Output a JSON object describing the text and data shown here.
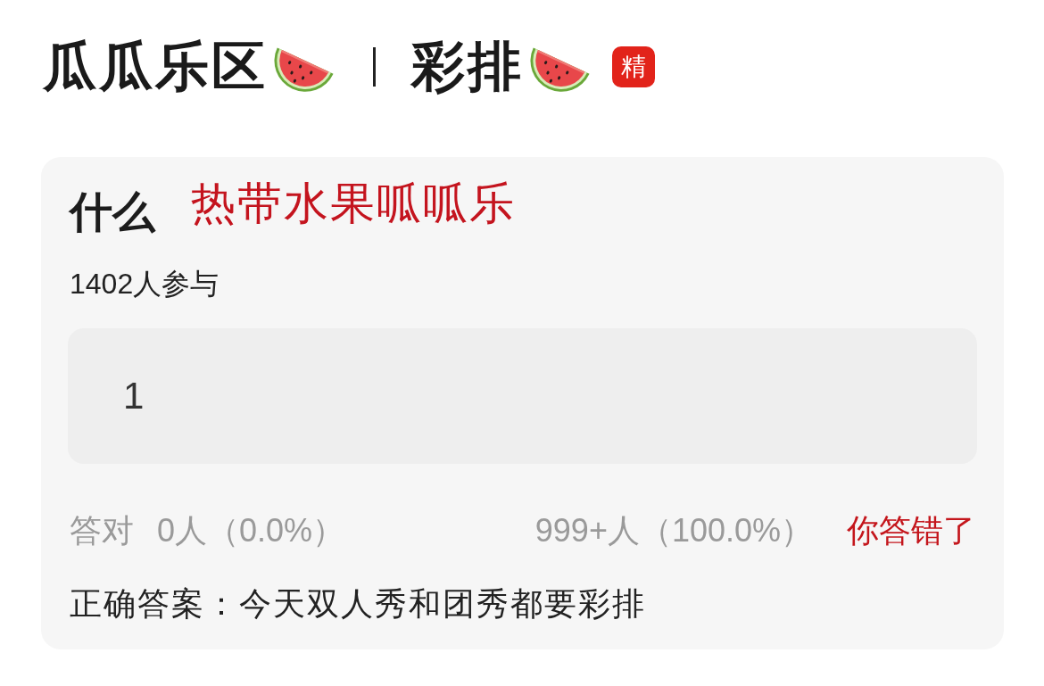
{
  "header": {
    "title_segments": [
      "瓜瓜乐区",
      "彩排"
    ],
    "badge": "精"
  },
  "quiz": {
    "question": "什么",
    "overlay_text": "热带水果呱呱乐",
    "participants": "1402人参与",
    "answer": "1",
    "stats": {
      "correct_label": "答对",
      "correct_count": "0人（0.0%）",
      "column_3": "999+人（100.0%）",
      "verdict": "你答错了"
    },
    "correct_answer": "正确答案：今天双人秀和团秀都要彩排"
  }
}
